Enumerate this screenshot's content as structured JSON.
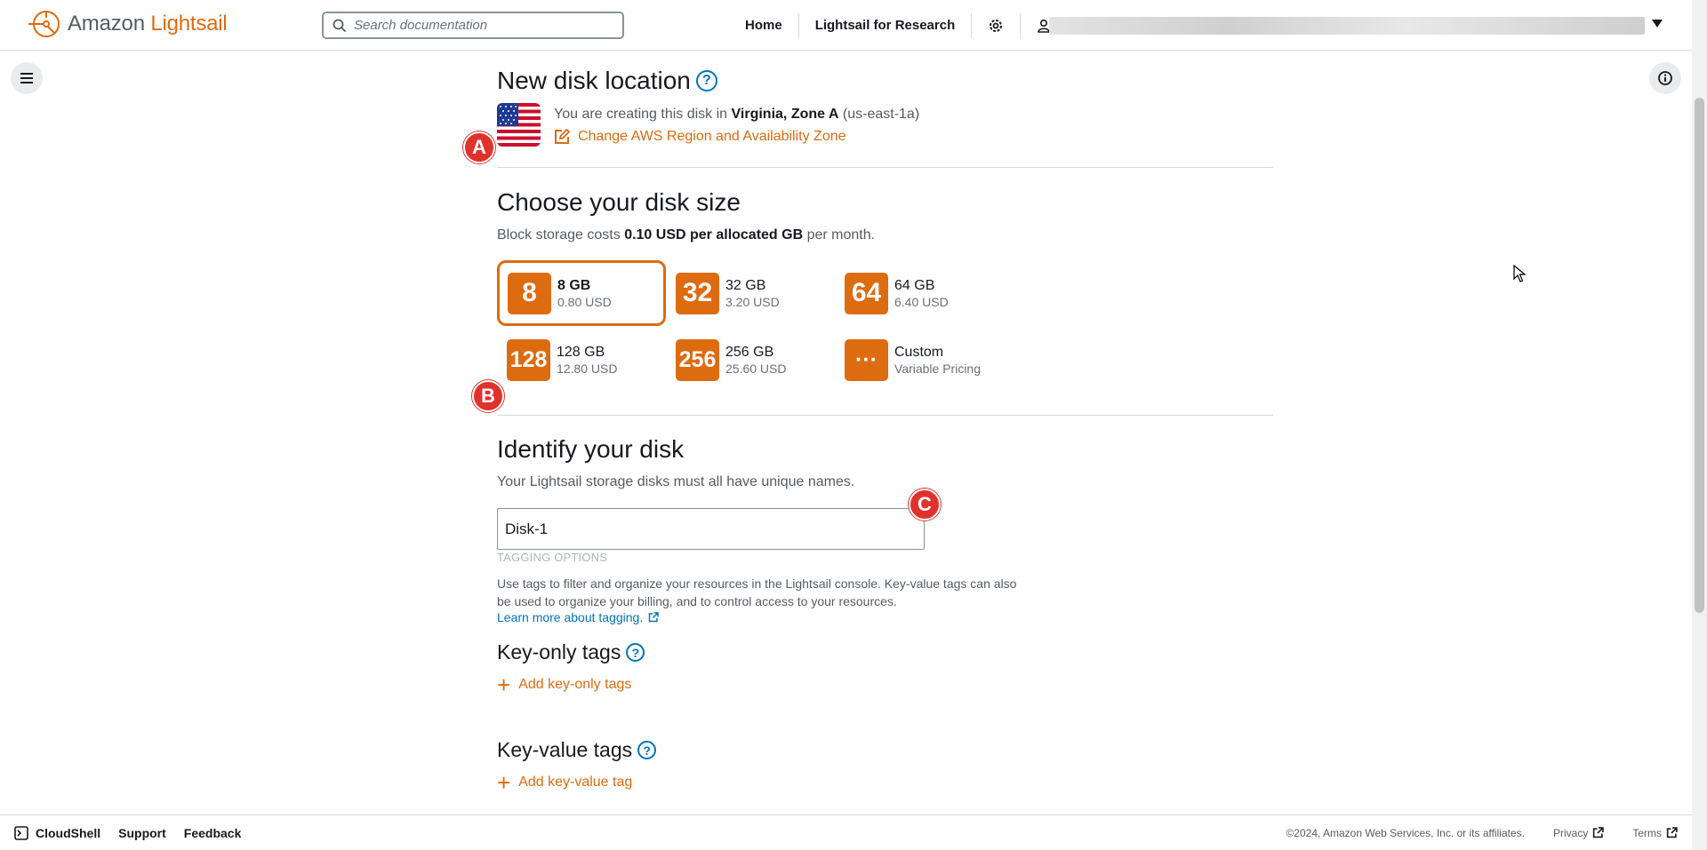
{
  "header": {
    "logo_prefix": "Amazon",
    "logo_brand": "Lightsail",
    "search_placeholder": "Search documentation",
    "nav": [
      {
        "label": "Home"
      },
      {
        "label": "Lightsail for Research"
      }
    ],
    "icons": [
      "gear-icon",
      "user-icon",
      "chevron-down-icon"
    ]
  },
  "location": {
    "title": "New disk location",
    "text_prefix": "You are creating this disk in",
    "region": "Virginia, Zone A",
    "zone_code": "(us-east-1a)",
    "change_link": "Change AWS Region and Availability Zone"
  },
  "disk_size": {
    "title": "Choose your disk size",
    "cost_prefix": "Block storage costs",
    "cost_bold": "0.10 USD per allocated GB",
    "cost_suffix": "per month.",
    "selected": "8 GB",
    "plans": [
      {
        "badge": "8",
        "title": "8 GB",
        "price": "0.80 USD"
      },
      {
        "badge": "32",
        "title": "32 GB",
        "price": "3.20 USD"
      },
      {
        "badge": "64",
        "title": "64 GB",
        "price": "6.40 USD"
      },
      {
        "badge": "128",
        "title": "128 GB",
        "price": "12.80 USD"
      },
      {
        "badge": "256",
        "title": "256 GB",
        "price": "25.60 USD"
      },
      {
        "badge": "···",
        "title": "Custom",
        "price": "Variable Pricing"
      }
    ]
  },
  "identify": {
    "title": "Identify your disk",
    "subtitle": "Your Lightsail storage disks must all have unique names.",
    "disk_name": "Disk-1",
    "tagging_label": "TAGGING OPTIONS",
    "tagging_desc": "Use tags to filter and organize your resources in the Lightsail console. Key-value tags can also be used to organize your billing, and to control access to your resources.",
    "learn_more": "Learn more about tagging.",
    "key_only_title": "Key-only tags",
    "add_key_only": "Add key-only tags",
    "key_value_title": "Key-value tags",
    "add_key_value": "Add key-value tag"
  },
  "markers": {
    "a": "A",
    "b": "B",
    "c": "C"
  },
  "footer": {
    "cloudshell": "CloudShell",
    "support": "Support",
    "feedback": "Feedback",
    "copyright": "©2024, Amazon Web Services, Inc. or its affiliates.",
    "privacy": "Privacy",
    "terms": "Terms"
  },
  "colors": {
    "accent": "#dd6b10",
    "link": "#0073bb",
    "marker": "#e0322d"
  }
}
